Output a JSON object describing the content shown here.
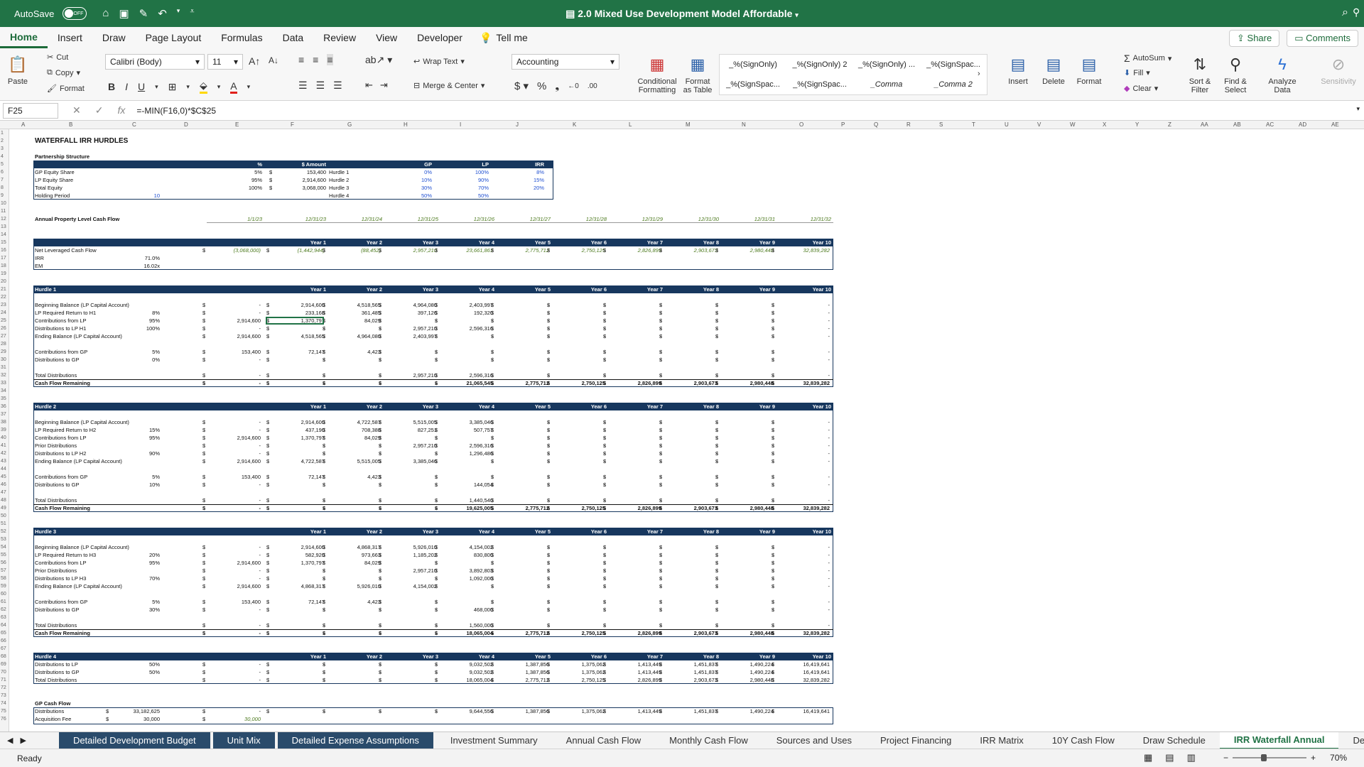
{
  "window": {
    "autosave": "AutoSave",
    "autosave_state": "OFF",
    "title": "2.0 Mixed Use Development Model Affordable"
  },
  "menu": {
    "tabs": [
      "Home",
      "Insert",
      "Draw",
      "Page Layout",
      "Formulas",
      "Data",
      "Review",
      "View",
      "Developer"
    ],
    "tell_me": "Tell me",
    "share": "Share",
    "comments": "Comments"
  },
  "ribbon": {
    "paste": "Paste",
    "cut": "Cut",
    "copy": "Copy",
    "format": "Format",
    "font_name": "Calibri (Body)",
    "font_size": "11",
    "wrap_text": "Wrap Text",
    "merge_center": "Merge & Center",
    "number_format": "Accounting",
    "conditional_formatting": "Conditional Formatting",
    "format_as_table": "Format as Table",
    "styles": [
      "_%(SignOnly)",
      "_%(SignOnly) 2",
      "_%(SignOnly) ...",
      "_%(SignSpac...",
      "_%(SignSpac...",
      "_%(SignSpac...",
      "_Comma",
      "_Comma 2"
    ],
    "insert": "Insert",
    "delete": "Delete",
    "format_cells": "Format",
    "autosum": "AutoSum",
    "fill": "Fill",
    "clear": "Clear",
    "sort_filter": "Sort & Filter",
    "find_select": "Find & Select",
    "analyze_data": "Analyze Data",
    "sensitivity": "Sensitivity"
  },
  "formula_bar": {
    "cell_ref": "F25",
    "formula": "=-MIN(F16,0)*$C$25"
  },
  "columns": [
    "A",
    "B",
    "C",
    "D",
    "E",
    "F",
    "G",
    "H",
    "I",
    "J",
    "K",
    "L",
    "M",
    "N",
    "O",
    "P",
    "Q",
    "R",
    "S",
    "T",
    "U",
    "V",
    "W",
    "X",
    "Y",
    "Z",
    "AA",
    "AB",
    "AC",
    "AD",
    "AE"
  ],
  "sheet": {
    "title": "WATERFALL IRR HURDLES",
    "partnership_title": "Partnership Structure",
    "partnership_headers": [
      "%",
      "$ Amount",
      "GP",
      "LP",
      "IRR"
    ],
    "partnership_rows": [
      {
        "label": "GP Equity Share",
        "pct": "5%",
        "amount": "153,400",
        "hurdle": "Hurdle 1",
        "gp": "0%",
        "lp": "100%",
        "irr": "8%"
      },
      {
        "label": "LP Equity Share",
        "pct": "95%",
        "amount": "2,914,600",
        "hurdle": "Hurdle 2",
        "gp": "10%",
        "lp": "90%",
        "irr": "15%"
      },
      {
        "label": "Total Equity",
        "pct": "100%",
        "amount": "3,068,000",
        "hurdle": "Hurdle 3",
        "gp": "30%",
        "lp": "70%",
        "irr": "20%"
      },
      {
        "label": "Holding Period",
        "pct": "10",
        "amount": "",
        "hurdle": "Hurdle 4",
        "gp": "50%",
        "lp": "50%",
        "irr": ""
      }
    ],
    "annual_label": "Annual Property Level Cash Flow",
    "dates": [
      "1/1/23",
      "12/31/23",
      "12/31/24",
      "12/31/25",
      "12/31/26",
      "12/31/27",
      "12/31/28",
      "12/31/29",
      "12/31/30",
      "12/31/31",
      "12/31/32"
    ],
    "years": [
      "Year 1",
      "Year 2",
      "Year 3",
      "Year 4",
      "Year 5",
      "Year 6",
      "Year 7",
      "Year 8",
      "Year 9",
      "Year 10"
    ],
    "nlcf": {
      "label": "Net Leveraged Cash Flow",
      "values": [
        "(3,068,000)",
        "(1,442,944)",
        "(88,452)",
        "2,957,210",
        "23,661,861",
        "2,775,712",
        "2,750,125",
        "2,826,899",
        "2,903,673",
        "2,980,448",
        "32,839,282"
      ]
    },
    "irr_row": {
      "label": "IRR",
      "value": "71.0%"
    },
    "em_row": {
      "label": "EM",
      "value": "16.02x"
    },
    "hurdles": [
      {
        "name": "Hurdle 1",
        "rows": [
          {
            "label": "Beginning Balance (LP Capital Account)",
            "c": "",
            "v": [
              "-",
              "2,914,600",
              "4,518,565",
              "4,964,080",
              "2,403,997",
              "-",
              "-",
              "-",
              "-",
              "-",
              "-"
            ]
          },
          {
            "label": "LP Required Return to H1",
            "c": "8%",
            "v": [
              "-",
              "233,168",
              "361,485",
              "397,126",
              "192,320",
              "-",
              "-",
              "-",
              "-",
              "-",
              "-"
            ]
          },
          {
            "label": "Contributions from LP",
            "c": "95%",
            "v": [
              "2,914,600",
              "1,370,797",
              "84,029",
              "-",
              "-",
              "-",
              "-",
              "-",
              "-",
              "-",
              "-"
            ]
          },
          {
            "label": "Distributions to LP H1",
            "c": "100%",
            "v": [
              "-",
              "-",
              "-",
              "2,957,210",
              "2,596,316",
              "-",
              "-",
              "-",
              "-",
              "-",
              "-"
            ]
          },
          {
            "label": "Ending Balance (LP Capital Account)",
            "c": "",
            "v": [
              "2,914,600",
              "4,518,565",
              "4,964,080",
              "2,403,997",
              "-",
              "-",
              "-",
              "-",
              "-",
              "-",
              "-"
            ]
          },
          {
            "label": "",
            "c": "",
            "v": []
          },
          {
            "label": "Contributions from GP",
            "c": "5%",
            "v": [
              "153,400",
              "72,147",
              "4,423",
              "-",
              "-",
              "-",
              "-",
              "-",
              "-",
              "-",
              "-"
            ]
          },
          {
            "label": "Distributions to GP",
            "c": "0%",
            "v": [
              "-",
              "-",
              "-",
              "-",
              "-",
              "-",
              "-",
              "-",
              "-",
              "-",
              "-"
            ]
          },
          {
            "label": "",
            "c": "",
            "v": []
          },
          {
            "label": "Total Distributions",
            "c": "",
            "v": [
              "-",
              "-",
              "-",
              "2,957,210",
              "2,596,316",
              "-",
              "-",
              "-",
              "-",
              "-",
              "-"
            ]
          },
          {
            "label": "Cash Flow Remaining",
            "c": "",
            "v": [
              "-",
              "-",
              "-",
              "-",
              "21,065,545",
              "2,775,712",
              "2,750,125",
              "2,826,899",
              "2,903,673",
              "2,980,448",
              "32,839,282"
            ],
            "bold": true
          }
        ]
      },
      {
        "name": "Hurdle 2",
        "rows": [
          {
            "label": "Beginning Balance (LP Capital Account)",
            "c": "",
            "v": [
              "-",
              "2,914,600",
              "4,722,587",
              "5,515,005",
              "3,385,046",
              "-",
              "-",
              "-",
              "-",
              "-",
              "-"
            ]
          },
          {
            "label": "LP Required Return to H2",
            "c": "15%",
            "v": [
              "-",
              "437,190",
              "708,388",
              "827,251",
              "507,757",
              "-",
              "-",
              "-",
              "-",
              "-",
              "-"
            ]
          },
          {
            "label": "Contributions from LP",
            "c": "95%",
            "v": [
              "2,914,600",
              "1,370,797",
              "84,029",
              "-",
              "-",
              "-",
              "-",
              "-",
              "-",
              "-",
              "-"
            ]
          },
          {
            "label": "Prior Distributions",
            "c": "",
            "v": [
              "-",
              "-",
              "-",
              "2,957,210",
              "2,596,316",
              "-",
              "-",
              "-",
              "-",
              "-",
              "-"
            ]
          },
          {
            "label": "Distributions to LP H2",
            "c": "90%",
            "v": [
              "-",
              "-",
              "-",
              "-",
              "1,296,486",
              "-",
              "-",
              "-",
              "-",
              "-",
              "-"
            ]
          },
          {
            "label": "Ending Balance (LP Capital Account)",
            "c": "",
            "v": [
              "2,914,600",
              "4,722,587",
              "5,515,005",
              "3,385,046",
              "-",
              "-",
              "-",
              "-",
              "-",
              "-",
              "-"
            ]
          },
          {
            "label": "",
            "c": "",
            "v": []
          },
          {
            "label": "Contributions from GP",
            "c": "5%",
            "v": [
              "153,400",
              "72,147",
              "4,423",
              "-",
              "-",
              "-",
              "-",
              "-",
              "-",
              "-",
              "-"
            ]
          },
          {
            "label": "Distributions to GP",
            "c": "10%",
            "v": [
              "-",
              "-",
              "-",
              "-",
              "144,054",
              "-",
              "-",
              "-",
              "-",
              "-",
              "-"
            ]
          },
          {
            "label": "",
            "c": "",
            "v": []
          },
          {
            "label": "Total Distributions",
            "c": "",
            "v": [
              "-",
              "-",
              "-",
              "-",
              "1,440,540",
              "-",
              "-",
              "-",
              "-",
              "-",
              "-"
            ]
          },
          {
            "label": "Cash Flow Remaining",
            "c": "",
            "v": [
              "-",
              "-",
              "-",
              "-",
              "19,625,005",
              "2,775,712",
              "2,750,125",
              "2,826,899",
              "2,903,673",
              "2,980,448",
              "32,839,282"
            ],
            "bold": true
          }
        ]
      },
      {
        "name": "Hurdle 3",
        "rows": [
          {
            "label": "Beginning Balance (LP Capital Account)",
            "c": "",
            "v": [
              "-",
              "2,914,600",
              "4,868,317",
              "5,926,010",
              "4,154,002",
              "-",
              "-",
              "-",
              "-",
              "-",
              "-"
            ]
          },
          {
            "label": "LP Required Return to H3",
            "c": "20%",
            "v": [
              "-",
              "582,920",
              "973,663",
              "1,185,202",
              "830,800",
              "-",
              "-",
              "-",
              "-",
              "-",
              "-"
            ]
          },
          {
            "label": "Contributions from LP",
            "c": "95%",
            "v": [
              "2,914,600",
              "1,370,797",
              "84,029",
              "-",
              "-",
              "-",
              "-",
              "-",
              "-",
              "-",
              "-"
            ]
          },
          {
            "label": "Prior Distributions",
            "c": "",
            "v": [
              "-",
              "-",
              "-",
              "2,957,210",
              "3,892,803",
              "-",
              "-",
              "-",
              "-",
              "-",
              "-"
            ]
          },
          {
            "label": "Distributions to LP H3",
            "c": "70%",
            "v": [
              "-",
              "-",
              "-",
              "-",
              "1,092,000",
              "-",
              "-",
              "-",
              "-",
              "-",
              "-"
            ]
          },
          {
            "label": "Ending Balance (LP Capital Account)",
            "c": "",
            "v": [
              "2,914,600",
              "4,868,317",
              "5,926,010",
              "4,154,002",
              "-",
              "-",
              "-",
              "-",
              "-",
              "-",
              "-"
            ]
          },
          {
            "label": "",
            "c": "",
            "v": []
          },
          {
            "label": "Contributions from GP",
            "c": "5%",
            "v": [
              "153,400",
              "72,147",
              "4,423",
              "-",
              "-",
              "-",
              "-",
              "-",
              "-",
              "-",
              "-"
            ]
          },
          {
            "label": "Distributions to GP",
            "c": "30%",
            "v": [
              "-",
              "-",
              "-",
              "-",
              "468,000",
              "-",
              "-",
              "-",
              "-",
              "-",
              "-"
            ]
          },
          {
            "label": "",
            "c": "",
            "v": []
          },
          {
            "label": "Total Distributions",
            "c": "",
            "v": [
              "-",
              "-",
              "-",
              "-",
              "1,560,000",
              "-",
              "-",
              "-",
              "-",
              "-",
              "-"
            ]
          },
          {
            "label": "Cash Flow Remaining",
            "c": "",
            "v": [
              "-",
              "-",
              "-",
              "-",
              "18,065,004",
              "2,775,712",
              "2,750,125",
              "2,826,899",
              "2,903,673",
              "2,980,448",
              "32,839,282"
            ],
            "bold": true
          }
        ]
      },
      {
        "name": "Hurdle 4",
        "rows": [
          {
            "label": "Distributions to LP",
            "c": "50%",
            "v": [
              "-",
              "-",
              "-",
              "-",
              "9,032,502",
              "1,387,856",
              "1,375,062",
              "1,413,449",
              "1,451,837",
              "1,490,224",
              "16,419,641"
            ]
          },
          {
            "label": "Distributions to GP",
            "c": "50%",
            "v": [
              "-",
              "-",
              "-",
              "-",
              "9,032,502",
              "1,387,856",
              "1,375,062",
              "1,413,449",
              "1,451,837",
              "1,490,224",
              "16,419,641"
            ]
          },
          {
            "label": "Total Distributions",
            "c": "",
            "v": [
              "-",
              "-",
              "-",
              "-",
              "18,065,004",
              "2,775,712",
              "2,750,125",
              "2,826,899",
              "2,903,673",
              "2,980,448",
              "32,839,282"
            ]
          }
        ]
      }
    ],
    "gp_cashflow": {
      "title": "GP Cash Flow",
      "rows": [
        {
          "label": "Distributions",
          "c": "33,182,625",
          "v": [
            "-",
            "-",
            "-",
            "-",
            "9,644,556",
            "1,387,856",
            "1,375,062",
            "1,413,449",
            "1,451,837",
            "1,490,224",
            "16,419,641"
          ]
        },
        {
          "label": "Acquisition Fee",
          "c": "30,000",
          "v": [
            "30,000"
          ]
        }
      ]
    }
  },
  "sheet_tabs": [
    {
      "label": "Detailed Development Budget",
      "style": "dk"
    },
    {
      "label": "Unit Mix",
      "style": "dk"
    },
    {
      "label": "Detailed Expense Assumptions",
      "style": "dk"
    },
    {
      "label": "Investment Summary",
      "style": ""
    },
    {
      "label": "Annual Cash Flow",
      "style": ""
    },
    {
      "label": "Monthly Cash Flow",
      "style": ""
    },
    {
      "label": "Sources and Uses",
      "style": ""
    },
    {
      "label": "Project Financing",
      "style": ""
    },
    {
      "label": "IRR Matrix",
      "style": ""
    },
    {
      "label": "10Y Cash Flow",
      "style": ""
    },
    {
      "label": "Draw Schedule",
      "style": ""
    },
    {
      "label": "IRR Waterfall Annual",
      "style": "act"
    },
    {
      "label": "Dev Intere",
      "style": ""
    }
  ],
  "status": {
    "ready": "Ready",
    "zoom": "70%"
  }
}
